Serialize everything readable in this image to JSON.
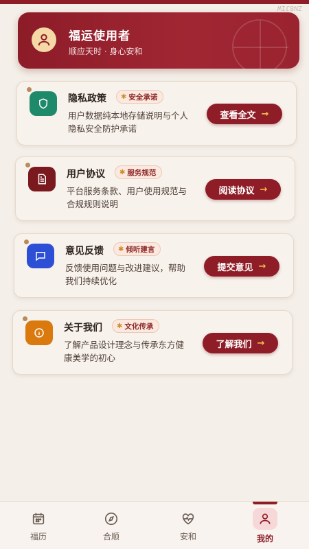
{
  "watermark": "ZN8JIW",
  "user": {
    "name": "福运使用者",
    "subtitle": "顺应天时 · 身心安和",
    "avatar_icon": "person-icon"
  },
  "cards": [
    {
      "title": "隐私政策",
      "badge": "安全承诺",
      "desc": "用户数据纯本地存储说明与个人隐私安全防护承诺",
      "action": "查看全文",
      "icon": "shield-icon",
      "icon_color": "#1f8a6a"
    },
    {
      "title": "用户协议",
      "badge": "服务规范",
      "desc": "平台服务条款、用户使用规范与合规规则说明",
      "action": "阅读协议",
      "icon": "document-icon",
      "icon_color": "#7a1a1e"
    },
    {
      "title": "意见反馈",
      "badge": "倾听建言",
      "desc": "反馈使用问题与改进建议，帮助我们持续优化",
      "action": "提交意见",
      "icon": "chat-icon",
      "icon_color": "#2c4fd6"
    },
    {
      "title": "关于我们",
      "badge": "文化传承",
      "desc": "了解产品设计理念与传承东方健康美学的初心",
      "action": "了解我们",
      "icon": "info-icon",
      "icon_color": "#d9790e"
    }
  ],
  "tabs": [
    {
      "label": "福历",
      "icon": "calendar-icon"
    },
    {
      "label": "合顺",
      "icon": "compass-icon"
    },
    {
      "label": "安和",
      "icon": "heart-pulse-icon"
    },
    {
      "label": "我的",
      "icon": "person-icon",
      "active": true
    }
  ],
  "colors": {
    "brand": "#8e1d27",
    "accent": "#f4c04f",
    "background": "#f4efe8"
  }
}
